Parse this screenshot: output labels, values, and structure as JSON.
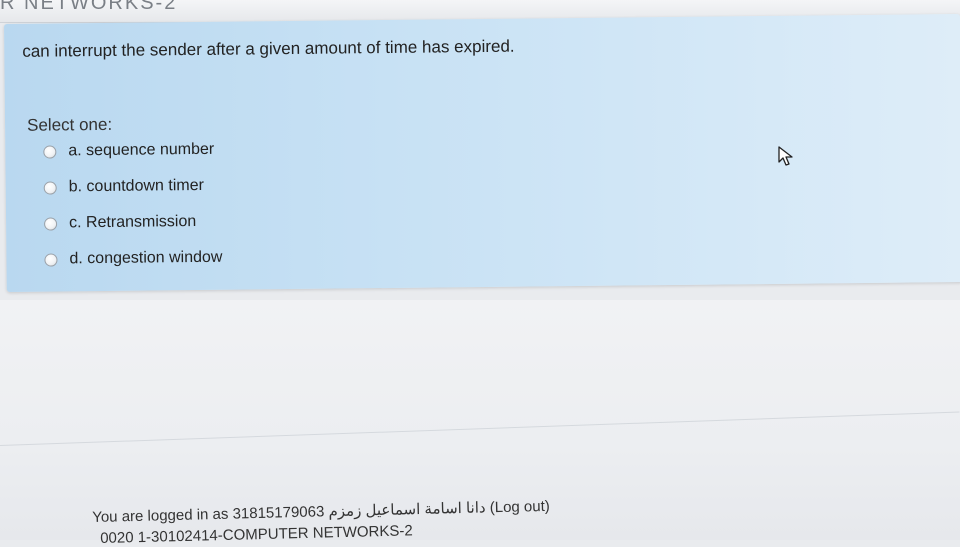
{
  "header": {
    "partial_title": "R NETWORKS-2"
  },
  "question": {
    "text": "can interrupt the sender after a given amount of time has expired.",
    "select_label": "Select one:",
    "options": [
      {
        "label": "a. sequence number"
      },
      {
        "label": "b. countdown timer"
      },
      {
        "label": "c. Retransmission"
      },
      {
        "label": "d. congestion window"
      }
    ]
  },
  "footer": {
    "logged_in_text": "You are logged in as 31815179063 دانا اسامة اسماعيل زمزم",
    "logout_label": "(Log out)",
    "course_text": "0020 1-30102414-COMPUTER NETWORKS-2"
  },
  "colors": {
    "card_bg": "#c7e1f4",
    "page_bg": "#eceef1",
    "text": "#222222"
  }
}
